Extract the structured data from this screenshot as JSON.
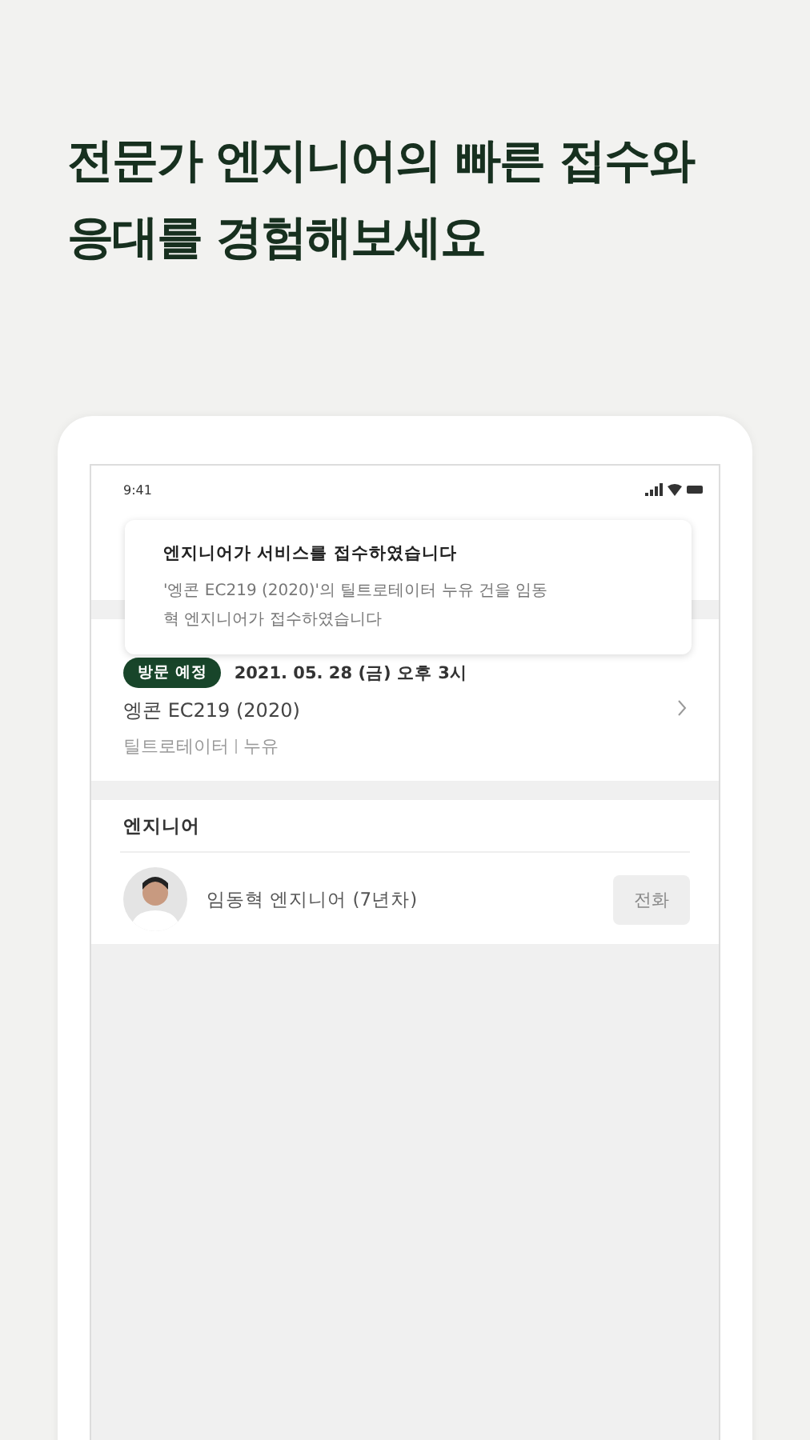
{
  "headline": "전문가 엔지니어의 빠른 접수와 응대를 경험해보세요",
  "status_bar": {
    "time": "9:41"
  },
  "notification": {
    "title": "엔지니어가 서비스를 접수하였습니다",
    "body": "'엥콘 EC219 (2020)'의 틸트로테이터 누유 건을 임동혁 엔지니어가 접수하였습니다"
  },
  "appointment": {
    "badge": "방문 예정",
    "datetime": "2021. 05. 28 (금) 오후 3시",
    "model": "엥콘 EC219 (2020)",
    "part": "틸트로테이터",
    "issue": "누유"
  },
  "engineer_section": {
    "title": "엔지니어",
    "name": "임동혁 엔지니어 (7년차)",
    "call_button": "전화"
  }
}
